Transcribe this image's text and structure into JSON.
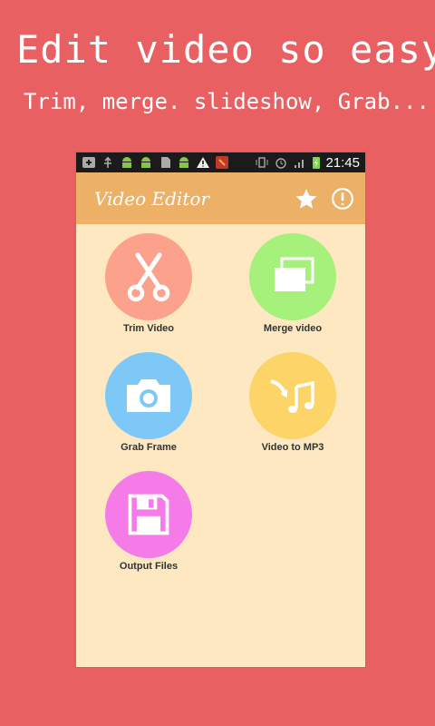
{
  "promo": {
    "title": "Edit video so easy",
    "subtitle": "Trim, merge. slideshow, Grab..."
  },
  "statusbar": {
    "time": "21:45",
    "battery_color": "#7CD64A"
  },
  "appbar": {
    "title": "Video Editor"
  },
  "tiles": [
    {
      "label": "Trim Video",
      "color": "#FCA28C",
      "icon": "scissors-icon"
    },
    {
      "label": "Merge video",
      "color": "#A6F07C",
      "icon": "windows-icon"
    },
    {
      "label": "Grab Frame",
      "color": "#7EC8F8",
      "icon": "camera-icon"
    },
    {
      "label": "Video to MP3",
      "color": "#FCD468",
      "icon": "music-icon"
    },
    {
      "label": "Output Files",
      "color": "#F57CE8",
      "icon": "floppy-disk-icon"
    }
  ],
  "colors": {
    "background": "#E86062",
    "appbar": "#EDB067",
    "content": "#FDE8C2"
  }
}
